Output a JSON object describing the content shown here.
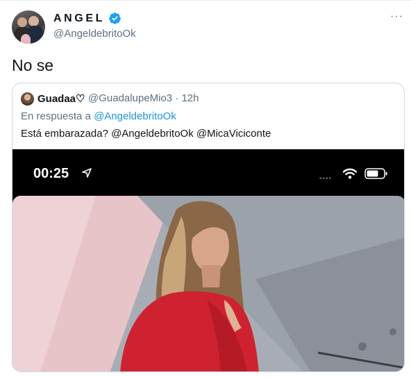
{
  "tweet": {
    "display_name": "ANGEL",
    "handle": "@AngeldebritoOk",
    "text": "No se",
    "more_label": "···"
  },
  "quoted": {
    "name": "Guadaa♡",
    "meta": "@GuadalupeMio3 · 12h",
    "reply_prefix": "En respuesta a ",
    "reply_mention": "@AngeldebritoOk",
    "text": "Está embarazada? @AngeldebritoOk @MicaViciconte",
    "media": {
      "status_time": "00:25",
      "signal_dots": "••••"
    }
  },
  "colors": {
    "accent": "#1da1f2",
    "secondary_text": "#5b7083",
    "border": "#cfd9de"
  },
  "icons": [
    "verified-badge-icon",
    "more-options-icon",
    "location-arrow-icon",
    "wifi-icon",
    "battery-icon"
  ]
}
